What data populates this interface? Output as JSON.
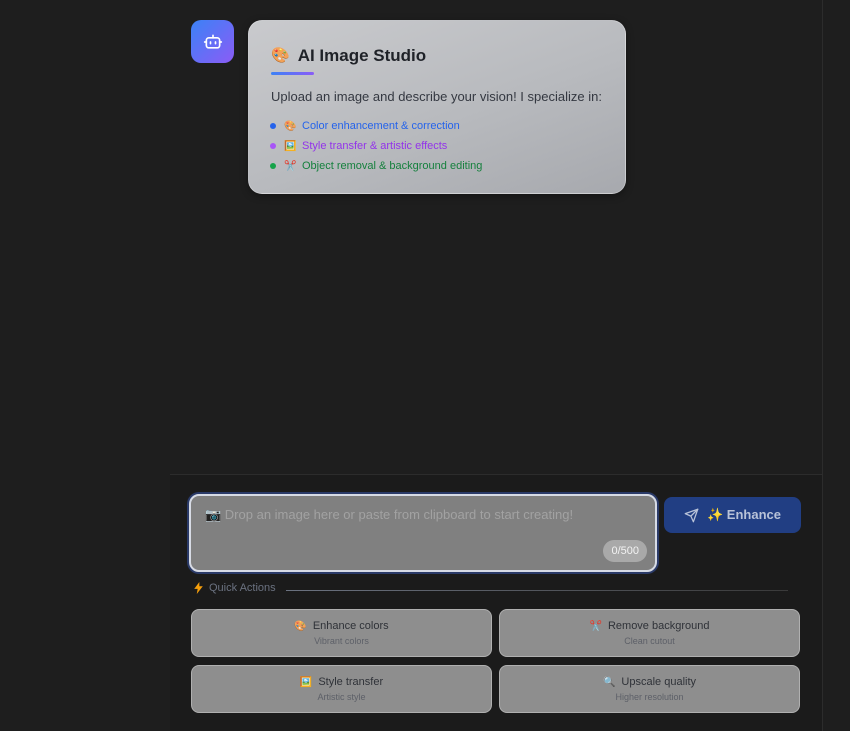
{
  "card": {
    "title_emoji": "🎨",
    "title": "AI Image Studio",
    "intro": "Upload an image and describe your vision! I specialize in:",
    "features": [
      {
        "emoji": "🎨",
        "label": "Color enhancement & correction",
        "color": "#2563eb"
      },
      {
        "emoji": "🖼️",
        "label": "Style transfer & artistic effects",
        "color": "#9333ea"
      },
      {
        "emoji": "✂️",
        "label": "Object removal & background editing",
        "color": "#15803d"
      }
    ]
  },
  "composer": {
    "placeholder": "📷 Drop an image here or paste from clipboard to start creating!",
    "counter": "0/500",
    "send_label": "✨ Enhance"
  },
  "quick_actions": {
    "label": "Quick Actions",
    "items": [
      {
        "emoji": "🎨",
        "title": "Enhance colors",
        "subtitle": "Vibrant colors"
      },
      {
        "emoji": "✂️",
        "title": "Remove background",
        "subtitle": "Clean cutout"
      },
      {
        "emoji": "🖼️",
        "title": "Style transfer",
        "subtitle": "Artistic style"
      },
      {
        "emoji": "🔍",
        "title": "Upscale quality",
        "subtitle": "Higher resolution"
      }
    ]
  },
  "colors": {
    "accent_blue": "#3b82f6",
    "accent_purple": "#8b5cf6",
    "button_bg": "#213e83"
  }
}
